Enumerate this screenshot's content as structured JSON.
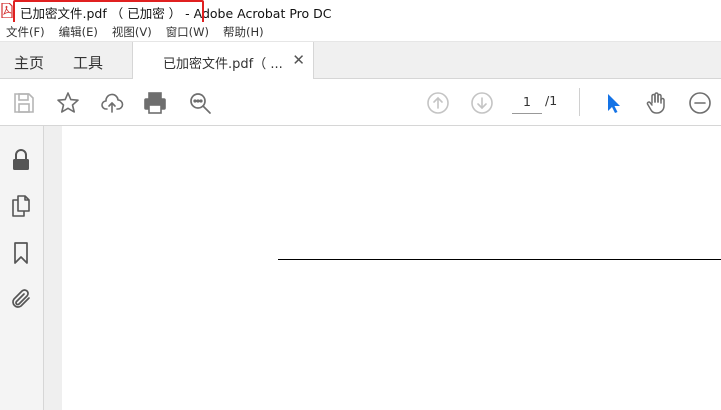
{
  "window": {
    "title": "已加密文件.pdf （ 已加密 ） - Adobe Acrobat Pro DC"
  },
  "menu": {
    "items": [
      "文件(F)",
      "编辑(E)",
      "视图(V)",
      "窗口(W)",
      "帮助(H)"
    ]
  },
  "tabs": {
    "home": "主页",
    "tools": "工具",
    "document": "已加密文件.pdf（ ...",
    "close_glyph": "✕"
  },
  "toolbar": {
    "current_page": "1",
    "total_pages": "/1",
    "accent_color": "#1473e6"
  },
  "colors": {
    "highlight_box": "#e02020",
    "icon": "#6e6e6e"
  }
}
